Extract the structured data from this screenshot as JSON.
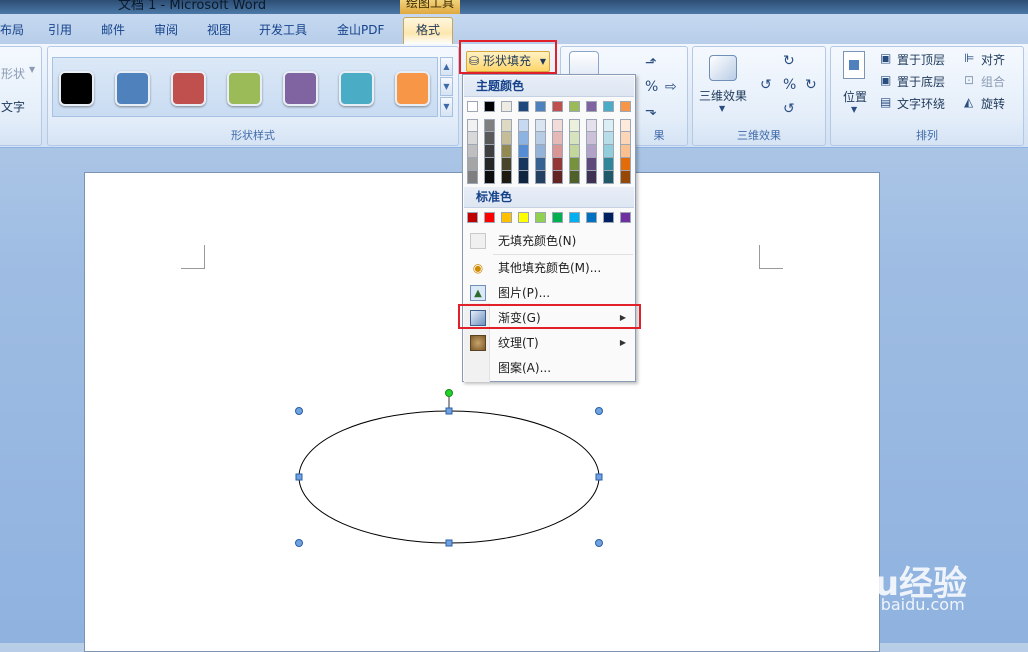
{
  "window": {
    "title": "文档 1 - Microsoft Word",
    "context_tab_group": "绘图工具"
  },
  "tabs": [
    {
      "label": "布局"
    },
    {
      "label": "引用"
    },
    {
      "label": "邮件"
    },
    {
      "label": "审阅"
    },
    {
      "label": "视图"
    },
    {
      "label": "开发工具"
    },
    {
      "label": "金山PDF"
    },
    {
      "label": "格式",
      "active": true
    }
  ],
  "ribbon": {
    "insert_shapes": {
      "shape_label": "形状",
      "text_label": "文字"
    },
    "shape_styles": {
      "group_label": "形状样式",
      "swatches": [
        "#000000",
        "#4f81bd",
        "#c0504d",
        "#9bbb59",
        "#8064a2",
        "#4bacc6",
        "#f79646"
      ]
    },
    "shape_fill": {
      "label": "形状填充"
    },
    "shadow_effects": {
      "group_label_partial": "果"
    },
    "effects_3d": {
      "button_label": "三维效果",
      "group_label": "三维效果"
    },
    "arrange": {
      "group_label": "排列",
      "position_label": "位置",
      "bring_front": "置于顶层",
      "send_back": "置于底层",
      "text_wrap": "文字环绕",
      "align": "对齐",
      "group": "组合",
      "rotate": "旋转"
    }
  },
  "fill_menu": {
    "theme_colors_header": "主题颜色",
    "theme_top_row": [
      "#ffffff",
      "#000000",
      "#eeece1",
      "#1f497d",
      "#4f81bd",
      "#c0504d",
      "#9bbb59",
      "#8064a2",
      "#4bacc6",
      "#f79646"
    ],
    "theme_shades": [
      [
        "#f2f2f2",
        "#7f7f7f",
        "#ddd9c3",
        "#c6d9f0",
        "#dbe5f1",
        "#f2dcdb",
        "#ebf1dd",
        "#e5e0ec",
        "#dbeef3",
        "#fdeada"
      ],
      [
        "#d8d8d8",
        "#595959",
        "#c4bd97",
        "#8db3e2",
        "#b8cce4",
        "#e5b9b7",
        "#d7e3bc",
        "#ccc1d9",
        "#b7dde8",
        "#fbd5b5"
      ],
      [
        "#bfbfbf",
        "#3f3f3f",
        "#938953",
        "#548dd4",
        "#95b3d7",
        "#d99694",
        "#c3d69b",
        "#b2a2c7",
        "#92cddc",
        "#fac08f"
      ],
      [
        "#a5a5a5",
        "#262626",
        "#494429",
        "#17365d",
        "#366092",
        "#953734",
        "#76923c",
        "#5f497a",
        "#31859b",
        "#e36c09"
      ],
      [
        "#7f7f7f",
        "#0c0c0c",
        "#1d1b10",
        "#0f243e",
        "#244061",
        "#632423",
        "#4f6128",
        "#3f3151",
        "#205867",
        "#974806"
      ]
    ],
    "standard_colors_header": "标准色",
    "standard_colors": [
      "#c00000",
      "#ff0000",
      "#ffc000",
      "#ffff00",
      "#92d050",
      "#00b050",
      "#00b0f0",
      "#0070c0",
      "#002060",
      "#7030a0"
    ],
    "items": [
      {
        "label": "无填充颜色(N)",
        "icon": "no-fill-icon"
      },
      {
        "label": "其他填充颜色(M)...",
        "icon": "palette-icon"
      },
      {
        "label": "图片(P)...",
        "icon": "picture-icon"
      },
      {
        "label": "渐变(G)",
        "icon": "gradient-icon",
        "submenu": true
      },
      {
        "label": "纹理(T)",
        "icon": "texture-icon",
        "submenu": true
      },
      {
        "label": "图案(A)...",
        "icon": ""
      }
    ]
  },
  "watermark": {
    "main": "Baidu经验",
    "sub": "jingyan.baidu.com"
  },
  "colors": {
    "highlight": "#e2202a",
    "ribbon_text": "#1e395b"
  }
}
